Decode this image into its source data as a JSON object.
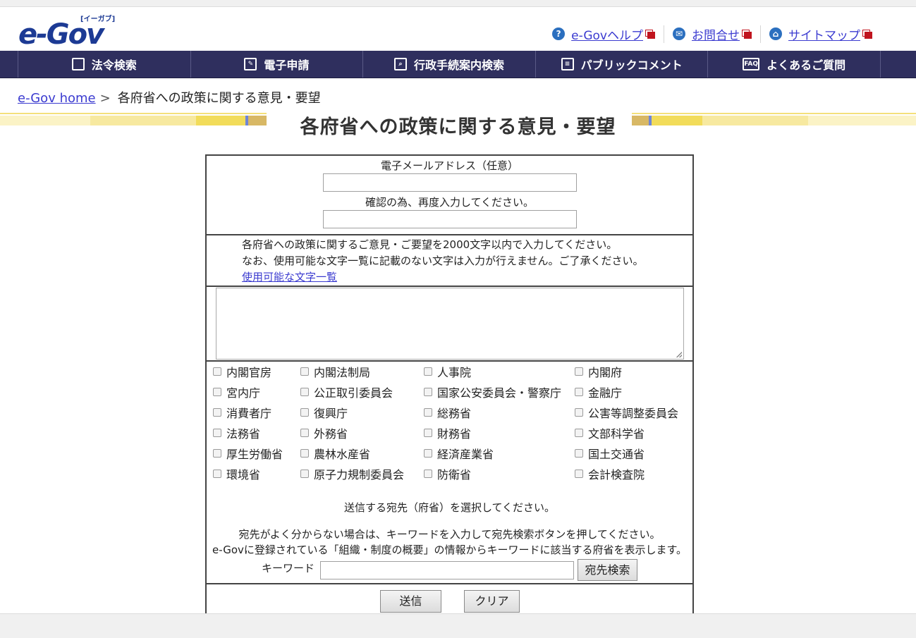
{
  "header": {
    "logo_text": "e-Gov",
    "logo_tag": "[イーガブ]",
    "links": [
      {
        "icon": "question-icon",
        "label": "e-Govヘルプ"
      },
      {
        "icon": "mail-icon",
        "label": "お問合せ"
      },
      {
        "icon": "sitemap-icon",
        "label": "サイトマップ"
      }
    ]
  },
  "nav": {
    "items": [
      {
        "icon": "book-icon",
        "label": "法令検索"
      },
      {
        "icon": "pen-icon",
        "label": "電子申請"
      },
      {
        "icon": "search-doc-icon",
        "label": "行政手続案内検索"
      },
      {
        "icon": "comment-icon",
        "label": "パブリックコメント"
      },
      {
        "icon": "faq-icon",
        "icon_text": "FAQ",
        "label": "よくあるご質問"
      }
    ]
  },
  "breadcrumb": {
    "home": "e-Gov home",
    "separator": ">",
    "current": "各府省への政策に関する意見・要望"
  },
  "page_title": "各府省への政策に関する意見・要望",
  "form": {
    "email_label": "電子メールアドレス（任意）",
    "email_value": "",
    "confirm_label": "確認の為、再度入力してください。",
    "confirm_value": "",
    "note_line1": "各府省への政策に関するご意見・ご要望を2000文字以内で入力してください。",
    "note_line2": "なお、使用可能な文字一覧に記載のない文字は入力が行えません。ご了承ください。",
    "note_link": "使用可能な文字一覧",
    "opinion_value": "",
    "ministries": [
      [
        "内閣官房",
        "内閣法制局",
        "人事院",
        "内閣府"
      ],
      [
        "宮内庁",
        "公正取引委員会",
        "国家公安委員会・警察庁",
        "金融庁"
      ],
      [
        "消費者庁",
        "復興庁",
        "総務省",
        "公害等調整委員会"
      ],
      [
        "法務省",
        "外務省",
        "財務省",
        "文部科学省"
      ],
      [
        "厚生労働省",
        "農林水産省",
        "経済産業省",
        "国土交通省"
      ],
      [
        "環境省",
        "原子力規制委員会",
        "防衛省",
        "会計検査院"
      ]
    ],
    "select_note": "送信する宛先（府省）を選択してください。",
    "help_line1": "宛先がよく分からない場合は、キーワードを入力して宛先検索ボタンを押してください。",
    "help_line2": "e-Govに登録されている「組織・制度の概要」の情報からキーワードに該当する府省を表示します。",
    "keyword_label": "キーワード",
    "keyword_value": "",
    "search_button": "宛先検索",
    "submit_button": "送信",
    "clear_button": "クリア"
  },
  "colors": {
    "nav_bg": "#2f2f5e",
    "link": "#3b3bd0",
    "band_yellow": "#f4e07a",
    "external_red": "#c0141e"
  }
}
